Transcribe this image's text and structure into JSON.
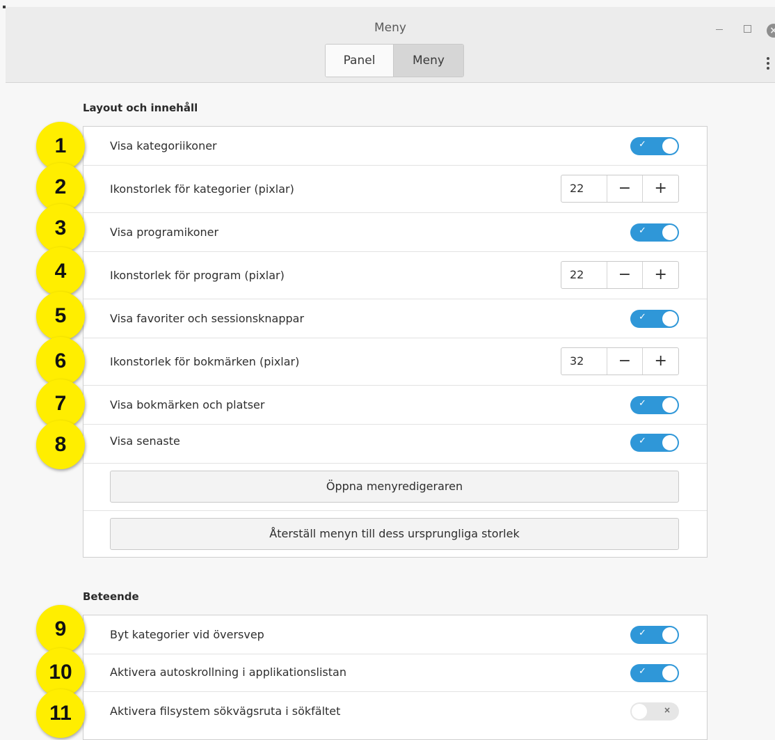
{
  "window": {
    "title": "Meny",
    "tabs": [
      {
        "label": "Panel",
        "active": false
      },
      {
        "label": "Meny",
        "active": true
      }
    ]
  },
  "layout_section": {
    "title": "Layout och innehåll",
    "rows": [
      {
        "label": "Visa kategoriikoner",
        "type": "toggle",
        "on": true
      },
      {
        "label": "Ikonstorlek för kategorier (pixlar)",
        "type": "spin",
        "value": "22"
      },
      {
        "label": "Visa programikoner",
        "type": "toggle",
        "on": true
      },
      {
        "label": "Ikonstorlek för program (pixlar)",
        "type": "spin",
        "value": "22"
      },
      {
        "label": "Visa favoriter och sessionsknappar",
        "type": "toggle",
        "on": true
      },
      {
        "label": "Ikonstorlek för bokmärken (pixlar)",
        "type": "spin",
        "value": "32"
      },
      {
        "label": "Visa bokmärken och platser",
        "type": "toggle",
        "on": true
      },
      {
        "label": "Visa senaste",
        "type": "toggle",
        "on": true
      }
    ],
    "buttons": [
      "Öppna menyredigeraren",
      "Återställ menyn till dess ursprungliga storlek"
    ]
  },
  "behavior_section": {
    "title": "Beteende",
    "rows": [
      {
        "label": "Byt kategorier vid översvep",
        "type": "toggle",
        "on": true
      },
      {
        "label": "Aktivera autoskrollning i applikationslistan",
        "type": "toggle",
        "on": true
      },
      {
        "label": "Aktivera filsystem sökvägsruta i sökfältet",
        "type": "toggle",
        "on": false
      }
    ]
  },
  "badges": [
    "1",
    "2",
    "3",
    "4",
    "5",
    "6",
    "7",
    "8",
    "9",
    "10",
    "11"
  ],
  "spin_symbols": {
    "minus": "−",
    "plus": "+"
  },
  "toggle_symbols": {
    "on": "✓",
    "off": "×"
  },
  "colors": {
    "toggle_on": "#2f97d8",
    "badge": "#ffee00"
  }
}
